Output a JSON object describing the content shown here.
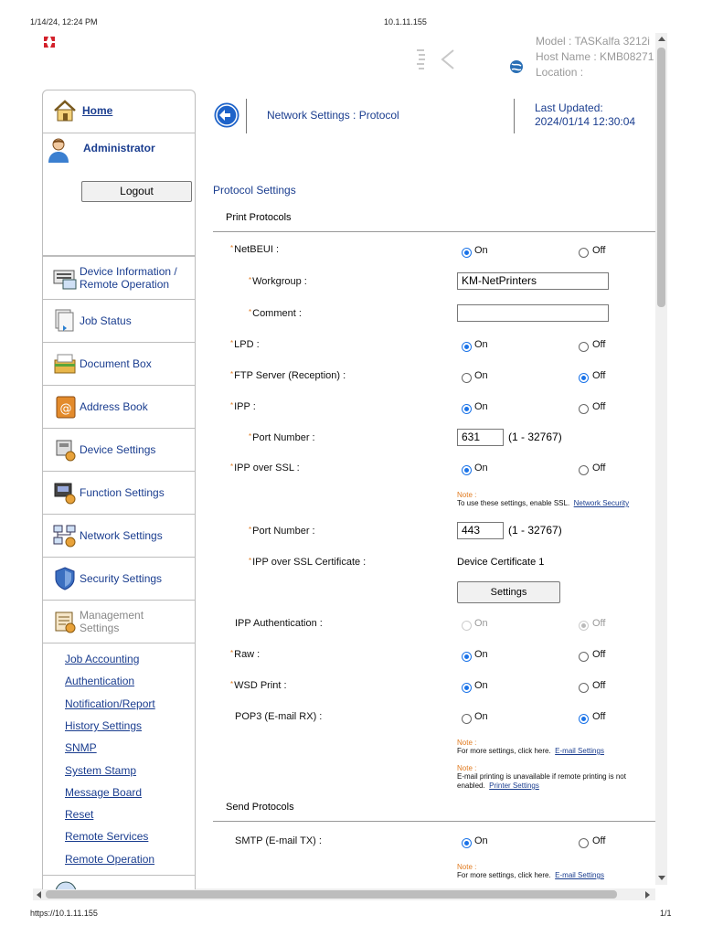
{
  "print_header": {
    "datetime": "1/14/24, 12:24 PM",
    "url_title": "10.1.11.155",
    "footer_url": "https://10.1.11.155",
    "page_count": "1/1"
  },
  "device_info": {
    "model": "Model : TASKalfa 3212i",
    "host": "Host Name : KMB08271",
    "location": "Location :"
  },
  "sidebar": {
    "home": "Home",
    "user": "Administrator",
    "logout": "Logout",
    "menu": [
      {
        "label": "Device Information / Remote Operation",
        "icon": "device-information-icon"
      },
      {
        "label": "Job Status",
        "icon": "job-status-icon"
      },
      {
        "label": "Document Box",
        "icon": "document-box-icon"
      },
      {
        "label": "Address Book",
        "icon": "address-book-icon"
      },
      {
        "label": "Device Settings",
        "icon": "device-settings-icon"
      },
      {
        "label": "Function Settings",
        "icon": "function-settings-icon"
      },
      {
        "label": "Network Settings",
        "icon": "network-settings-icon"
      },
      {
        "label": "Security Settings",
        "icon": "security-settings-icon"
      },
      {
        "label": "Management Settings",
        "icon": "management-settings-icon"
      }
    ],
    "submenu": [
      "Job Accounting",
      "Authentication",
      "Notification/Report",
      "History Settings",
      "SNMP",
      "System Stamp",
      "Message Board",
      "Reset",
      "Remote Services",
      "Remote Operation"
    ]
  },
  "header": {
    "breadcrumb": "Network Settings : Protocol",
    "last_updated_label": "Last Updated:",
    "last_updated_value": "2024/01/14 12:30:04"
  },
  "main": {
    "section_title": "Protocol Settings",
    "print_protocols": "Print Protocols",
    "send_protocols": "Send Protocols",
    "on": "On",
    "off": "Off",
    "port_range": "(1 - 32767)",
    "note": "Note :",
    "rows": {
      "netbeui": {
        "label": "NetBEUI :",
        "value": "On"
      },
      "workgroup": {
        "label": "Workgroup :",
        "value": "KM-NetPrinters"
      },
      "comment": {
        "label": "Comment :",
        "value": ""
      },
      "lpd": {
        "label": "LPD :",
        "value": "On"
      },
      "ftp": {
        "label": "FTP Server (Reception) :",
        "value": "Off"
      },
      "ipp": {
        "label": "IPP :",
        "value": "On"
      },
      "ipp_port": {
        "label": "Port Number :",
        "value": "631"
      },
      "ipp_ssl": {
        "label": "IPP over SSL :",
        "value": "On"
      },
      "ipp_ssl_note": {
        "text": "To use these settings, enable SSL.",
        "link": "Network Security"
      },
      "ssl_port": {
        "label": "Port Number :",
        "value": "443"
      },
      "ssl_cert": {
        "label": "IPP over SSL Certificate :",
        "value": "Device Certificate 1",
        "button": "Settings"
      },
      "ipp_auth": {
        "label": "IPP Authentication :",
        "value": "Off"
      },
      "raw": {
        "label": "Raw :",
        "value": "On"
      },
      "wsd": {
        "label": "WSD Print :",
        "value": "On"
      },
      "pop3": {
        "label": "POP3 (E-mail RX) :",
        "value": "Off"
      },
      "pop3_note1": {
        "text": "For more settings, click here.",
        "link": "E-mail Settings"
      },
      "pop3_note2": {
        "text1": "E-mail printing is unavailable if remote printing is not",
        "text2": "enabled.",
        "link": "Printer Settings"
      },
      "smtp": {
        "label": "SMTP (E-mail TX) :",
        "value": "On"
      },
      "smtp_note": {
        "text": "For more settings, click here.",
        "link": "E-mail Settings"
      }
    }
  },
  "colors": {
    "accent": "#1a73e8",
    "link": "#1a3d8f",
    "required": "#e07a1f"
  }
}
